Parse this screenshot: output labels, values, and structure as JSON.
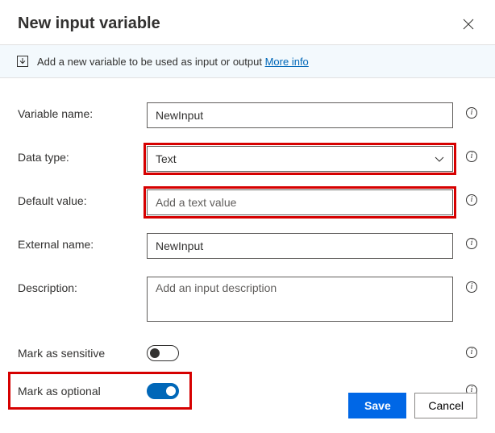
{
  "dialog": {
    "title": "New input variable",
    "banner_text": "Add a new variable to be used as input or output",
    "more_info": "More info"
  },
  "fields": {
    "variable_name": {
      "label": "Variable name:",
      "value": "NewInput"
    },
    "data_type": {
      "label": "Data type:",
      "value": "Text"
    },
    "default_value": {
      "label": "Default value:",
      "placeholder": "Add a text value",
      "value": ""
    },
    "external_name": {
      "label": "External name:",
      "value": "NewInput"
    },
    "description": {
      "label": "Description:",
      "placeholder": "Add an input description",
      "value": ""
    },
    "mark_sensitive": {
      "label": "Mark as sensitive",
      "on": false
    },
    "mark_optional": {
      "label": "Mark as optional",
      "on": true
    }
  },
  "buttons": {
    "save": "Save",
    "cancel": "Cancel"
  }
}
